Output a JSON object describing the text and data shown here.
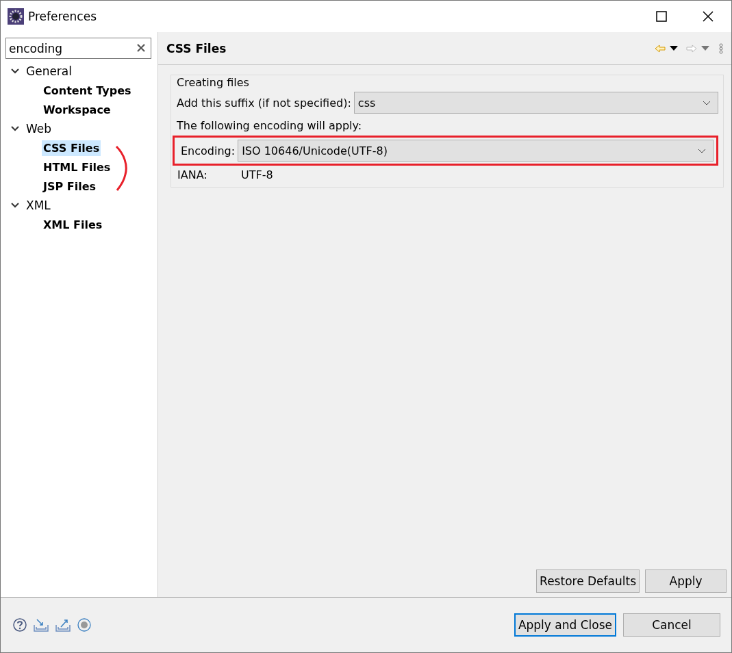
{
  "window": {
    "title": "Preferences"
  },
  "search": {
    "value": "encoding"
  },
  "tree": [
    {
      "label": "General",
      "expanded": true,
      "children": [
        {
          "label": "Content Types",
          "selected": false
        },
        {
          "label": "Workspace",
          "selected": false
        }
      ]
    },
    {
      "label": "Web",
      "expanded": true,
      "children": [
        {
          "label": "CSS Files",
          "selected": true
        },
        {
          "label": "HTML Files",
          "selected": false
        },
        {
          "label": "JSP Files",
          "selected": false
        }
      ]
    },
    {
      "label": "XML",
      "expanded": true,
      "children": [
        {
          "label": "XML Files",
          "selected": false
        }
      ]
    }
  ],
  "page": {
    "title": "CSS Files",
    "group": {
      "title": "Creating files",
      "suffix_label": "Add this suffix (if not specified):",
      "suffix_value": "css",
      "note": "The following encoding will apply:",
      "encoding_label": "Encoding:",
      "encoding_value": "ISO 10646/Unicode(UTF-8)",
      "iana_label": "IANA:",
      "iana_value": "UTF-8"
    },
    "buttons": [
      "Restore Defaults",
      "Apply"
    ]
  },
  "footer": {
    "buttons": [
      {
        "label": "Apply and Close",
        "default": true
      },
      {
        "label": "Cancel",
        "default": false
      }
    ]
  }
}
